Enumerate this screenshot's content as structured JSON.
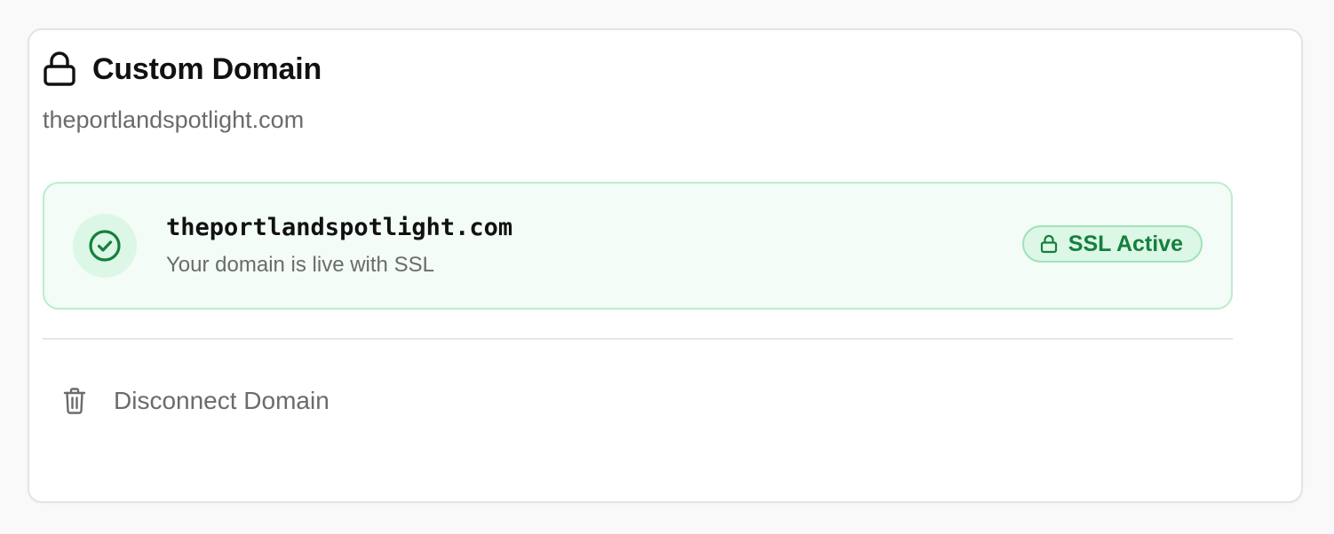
{
  "card": {
    "title": "Custom Domain",
    "title_icon": "lock-icon",
    "subtitle": "theportlandspotlight.com"
  },
  "status": {
    "icon": "check-circle-icon",
    "domain": "theportlandspotlight.com",
    "message": "Your domain is live with SSL",
    "badge_label": "SSL Active",
    "badge_icon": "lock-icon",
    "accent_color": "#15803d",
    "background_color": "#f3fcf6",
    "border_color": "#bdeccc"
  },
  "actions": {
    "disconnect_label": "Disconnect Domain",
    "disconnect_icon": "trash-icon"
  }
}
